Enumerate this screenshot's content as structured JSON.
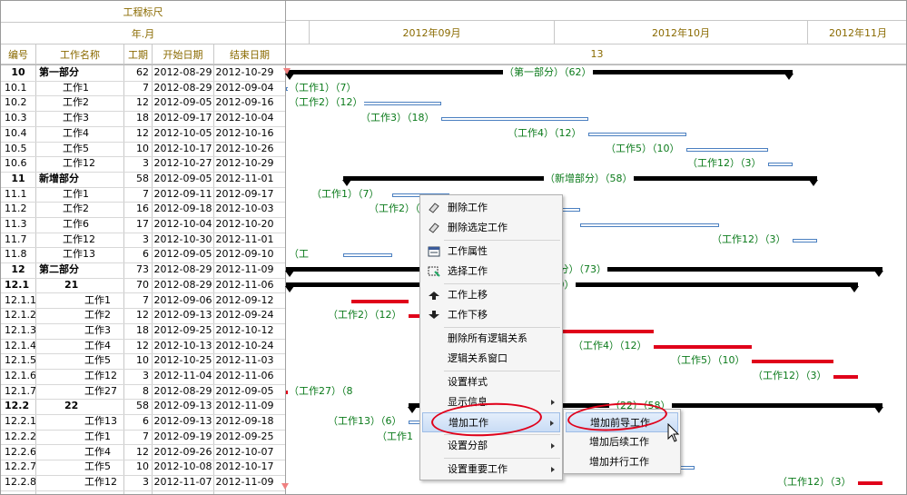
{
  "header": {
    "ruler_title": "工程标尺",
    "year_month_label": "年.月",
    "months": [
      "2012年09月",
      "2012年10月",
      "2012年11月"
    ],
    "week_number": "13"
  },
  "columns": {
    "code": "编号",
    "name": "工作名称",
    "duration": "工期",
    "start": "开始日期",
    "end": "结束日期"
  },
  "rows": [
    {
      "code": "10",
      "name": "第一部分",
      "dur": "62",
      "start": "2012-08-29",
      "end": "2012-10-29",
      "bold": true,
      "indent": 0
    },
    {
      "code": "10.1",
      "name": "工作1",
      "dur": "7",
      "start": "2012-08-29",
      "end": "2012-09-04",
      "indent": 1
    },
    {
      "code": "10.2",
      "name": "工作2",
      "dur": "12",
      "start": "2012-09-05",
      "end": "2012-09-16",
      "indent": 1
    },
    {
      "code": "10.3",
      "name": "工作3",
      "dur": "18",
      "start": "2012-09-17",
      "end": "2012-10-04",
      "indent": 1
    },
    {
      "code": "10.4",
      "name": "工作4",
      "dur": "12",
      "start": "2012-10-05",
      "end": "2012-10-16",
      "indent": 1
    },
    {
      "code": "10.5",
      "name": "工作5",
      "dur": "10",
      "start": "2012-10-17",
      "end": "2012-10-26",
      "indent": 1
    },
    {
      "code": "10.6",
      "name": "工作12",
      "dur": "3",
      "start": "2012-10-27",
      "end": "2012-10-29",
      "indent": 1
    },
    {
      "code": "11",
      "name": "新增部分",
      "dur": "58",
      "start": "2012-09-05",
      "end": "2012-11-01",
      "bold": true,
      "indent": 0
    },
    {
      "code": "11.1",
      "name": "工作1",
      "dur": "7",
      "start": "2012-09-11",
      "end": "2012-09-17",
      "indent": 1
    },
    {
      "code": "11.2",
      "name": "工作2",
      "dur": "16",
      "start": "2012-09-18",
      "end": "2012-10-03",
      "indent": 1
    },
    {
      "code": "11.3",
      "name": "工作6",
      "dur": "17",
      "start": "2012-10-04",
      "end": "2012-10-20",
      "indent": 1
    },
    {
      "code": "11.7",
      "name": "工作12",
      "dur": "3",
      "start": "2012-10-30",
      "end": "2012-11-01",
      "indent": 1
    },
    {
      "code": "11.8",
      "name": "工作13",
      "dur": "6",
      "start": "2012-09-05",
      "end": "2012-09-10",
      "indent": 1
    },
    {
      "code": "12",
      "name": "第二部分",
      "dur": "73",
      "start": "2012-08-29",
      "end": "2012-11-09",
      "bold": true,
      "indent": 0
    },
    {
      "code": "12.1",
      "name": "21",
      "dur": "70",
      "start": "2012-08-29",
      "end": "2012-11-06",
      "bold": true,
      "indent": 2
    },
    {
      "code": "12.1.1",
      "name": "工作1",
      "dur": "7",
      "start": "2012-09-06",
      "end": "2012-09-12",
      "indent": 3
    },
    {
      "code": "12.1.2",
      "name": "工作2",
      "dur": "12",
      "start": "2012-09-13",
      "end": "2012-09-24",
      "indent": 3
    },
    {
      "code": "12.1.3",
      "name": "工作3",
      "dur": "18",
      "start": "2012-09-25",
      "end": "2012-10-12",
      "indent": 3
    },
    {
      "code": "12.1.4",
      "name": "工作4",
      "dur": "12",
      "start": "2012-10-13",
      "end": "2012-10-24",
      "indent": 3
    },
    {
      "code": "12.1.5",
      "name": "工作5",
      "dur": "10",
      "start": "2012-10-25",
      "end": "2012-11-03",
      "indent": 3
    },
    {
      "code": "12.1.6",
      "name": "工作12",
      "dur": "3",
      "start": "2012-11-04",
      "end": "2012-11-06",
      "indent": 3
    },
    {
      "code": "12.1.7",
      "name": "工作27",
      "dur": "8",
      "start": "2012-08-29",
      "end": "2012-09-05",
      "indent": 3
    },
    {
      "code": "12.2",
      "name": "22",
      "dur": "58",
      "start": "2012-09-13",
      "end": "2012-11-09",
      "bold": true,
      "indent": 2
    },
    {
      "code": "12.2.1",
      "name": "工作13",
      "dur": "6",
      "start": "2012-09-13",
      "end": "2012-09-18",
      "indent": 3
    },
    {
      "code": "12.2.2",
      "name": "工作1",
      "dur": "7",
      "start": "2012-09-19",
      "end": "2012-09-25",
      "indent": 3
    },
    {
      "code": "12.2.6",
      "name": "工作4",
      "dur": "12",
      "start": "2012-09-26",
      "end": "2012-10-07",
      "indent": 3
    },
    {
      "code": "12.2.7",
      "name": "工作5",
      "dur": "10",
      "start": "2012-10-08",
      "end": "2012-10-17",
      "indent": 3
    },
    {
      "code": "12.2.8",
      "name": "工作12",
      "dur": "3",
      "start": "2012-11-07",
      "end": "2012-11-09",
      "indent": 3
    }
  ],
  "gantt_labels": {
    "r0": "（第一部分）（62）",
    "r1": "（工作1）（7）",
    "r2": "（工作2）（12）",
    "r3": "（工作3）（18）",
    "r4": "（工作4）（12）",
    "r5": "（工作5）（10）",
    "r6": "（工作12）（3）",
    "r7": "（新增部分）（58）",
    "r8": "（工作1）（7）",
    "r9": "（工作2）（",
    "r10": "）",
    "r11": "（工作12）（3）",
    "r12": "（工",
    "r13": "部分）（73）",
    "r14": "）（70）",
    "r16": "（工作2）（12）",
    "r18": "（工作4）（12）",
    "r19": "（工作5）（10）",
    "r20": "（工作12）（3）",
    "r21": "（工作27）（8",
    "r22": "（22）（58）",
    "r23": "（工作13）（6）",
    "r24": "（工作1",
    "r27": "（工作12）（3）"
  },
  "context_menu": {
    "items": [
      {
        "label": "删除工作",
        "icon": "eraser-icon"
      },
      {
        "label": "删除选定工作",
        "icon": "eraser-icon"
      },
      {
        "label": "工作属性",
        "icon": "properties-icon"
      },
      {
        "label": "选择工作",
        "icon": "select-icon"
      },
      {
        "label": "工作上移",
        "icon": "move-up-icon"
      },
      {
        "label": "工作下移",
        "icon": "move-down-icon"
      },
      {
        "label": "删除所有逻辑关系"
      },
      {
        "label": "逻辑关系窗口"
      },
      {
        "label": "设置样式"
      },
      {
        "label": "显示信息",
        "submenu": true
      },
      {
        "label": "增加工作",
        "submenu": true,
        "selected": true
      },
      {
        "label": "设置分部",
        "submenu": true
      },
      {
        "label": "设置重要工作",
        "submenu": true
      }
    ]
  },
  "submenu": {
    "items": [
      {
        "label": "增加前导工作",
        "selected": true
      },
      {
        "label": "增加后续工作"
      },
      {
        "label": "增加并行工作"
      }
    ]
  },
  "colors": {
    "header_text": "#8a6a00",
    "label_green": "#0a7a1a",
    "critical_red": "#e0001a",
    "task_blue": "#4a7fc0"
  }
}
